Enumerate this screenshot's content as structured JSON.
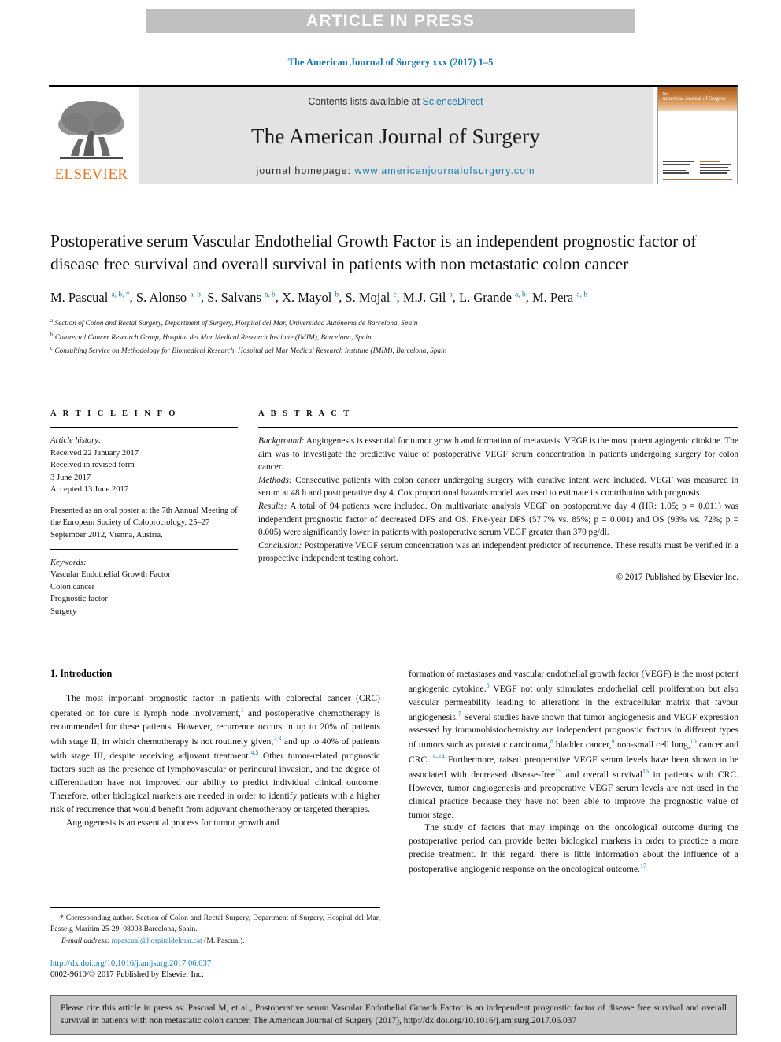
{
  "banner": {
    "text": "ARTICLE IN PRESS"
  },
  "running_head": {
    "text": "The American Journal of Surgery xxx (2017) 1–5"
  },
  "masthead": {
    "contents_prefix": "Contents lists available at ",
    "sciencedirect": "ScienceDirect",
    "journal_title": "The American Journal of Surgery",
    "homepage_prefix": "journal homepage: ",
    "homepage_url": "www.americanjournalofsurgery.com",
    "elsevier_wordmark": "ELSEVIER",
    "cover_title_small": "The",
    "cover_title": "American Journal of Surgery"
  },
  "article": {
    "title": "Postoperative serum Vascular Endothelial Growth Factor is an independent prognostic factor of disease free survival and overall survival in patients with non metastatic colon cancer",
    "authors": [
      {
        "name": "M. Pascual",
        "marks": "a, b, *"
      },
      {
        "name": "S. Alonso",
        "marks": "a, b"
      },
      {
        "name": "S. Salvans",
        "marks": "a, b"
      },
      {
        "name": "X. Mayol",
        "marks": "b"
      },
      {
        "name": "S. Mojal",
        "marks": "c"
      },
      {
        "name": "M.J. Gil",
        "marks": "a"
      },
      {
        "name": "L. Grande",
        "marks": "a, b"
      },
      {
        "name": "M. Pera",
        "marks": "a, b"
      }
    ],
    "affiliations": [
      {
        "mark": "a",
        "text": "Section of Colon and Rectal Surgery, Department of Surgery, Hospital del Mar, Universidad Autónoma de Barcelona, Spain"
      },
      {
        "mark": "b",
        "text": "Colorectal Cancer Research Group, Hospital del Mar Medical Research Institute (IMIM), Barcelona, Spain"
      },
      {
        "mark": "c",
        "text": "Consulting Service on Methodology for Biomedical Research, Hospital del Mar Medical Research Institute (IMIM), Barcelona, Spain"
      }
    ]
  },
  "article_info": {
    "heading": "A R T I C L E   I N F O",
    "history_label": "Article history:",
    "history_lines": [
      "Received 22 January 2017",
      "Received in revised form",
      "3 June 2017",
      "Accepted 13 June 2017"
    ],
    "presented": "Presented as an oral poster at the 7th Annual Meeting of the European Society of Coloproctology, 25–27 September 2012, Vienna, Austria.",
    "keywords_label": "Keywords:",
    "keywords": [
      "Vascular Endothelial Growth Factor",
      "Colon cancer",
      "Prognostic factor",
      "Surgery"
    ]
  },
  "abstract": {
    "heading": "A B S T R A C T",
    "sections": [
      {
        "label": "Background:",
        "text": " Angiogenesis is essential for tumor growth and formation of metastasis. VEGF is the most potent agiogenic citokine. The aim was to investigate the predictive value of postoperative VEGF serum concentration in patients undergoing surgery for colon cancer."
      },
      {
        "label": "Methods:",
        "text": " Consecutive patients with colon cancer undergoing surgery with curative intent were included. VEGF was measured in serum at 48 h and postoperative day 4. Cox proportional hazards model was used to estimate its contribution with prognosis."
      },
      {
        "label": "Results:",
        "text": " A total of 94 patients were included. On multivariate analysis VEGF on postoperative day 4 (HR: 1.05; p = 0.011) was independent prognostic factor of decreased DFS and OS. Five-year DFS (57.7% vs. 85%; p = 0.001) and OS (93% vs. 72%; p = 0.005) were significantly lower in patients with postoperative serum VEGF greater than 370 pg/dl."
      },
      {
        "label": "Conclusion:",
        "text": " Postoperative VEGF serum concentration was an independent predictor of recurrence. These results must be verified in a prospective independent testing cohort."
      }
    ],
    "copyright": "© 2017 Published by Elsevier Inc."
  },
  "body": {
    "section_heading": "1. Introduction",
    "left_paragraphs": [
      {
        "runs": [
          {
            "t": "The most important prognostic factor in patients with colorectal cancer (CRC) operated on for cure is lymph node involvement,"
          },
          {
            "sup": "1"
          },
          {
            "t": " and postoperative chemotherapy is recommended for these patients. However, recurrence occurs in up to 20% of patients with stage II, in which chemotherapy is not routinely given,"
          },
          {
            "sup": "2,3"
          },
          {
            "t": " and up to 40% of patients with stage III, despite receiving adjuvant treatment."
          },
          {
            "sup": "4,5"
          },
          {
            "t": " Other tumor-related prognostic factors such as the presence of lymphovascular or perineural invasion, and the degree of differentiation have not improved our ability to predict individual clinical outcome. Therefore, other biological markers are needed in order to identify patients with a higher risk of recurrence that would benefit from adjuvant chemotherapy or targeted therapies."
          }
        ]
      },
      {
        "runs": [
          {
            "t": "Angiogenesis is an essential process for tumor growth and"
          }
        ]
      }
    ],
    "right_paragraphs": [
      {
        "runs": [
          {
            "t": "formation of metastases and vascular endothelial growth factor (VEGF) is the most potent angiogenic cytokine."
          },
          {
            "sup": "6"
          },
          {
            "t": " VEGF not only stimulates endothelial cell proliferation but also vascular permeability leading to alterations in the extracellular matrix that favour angiogenesis."
          },
          {
            "sup": "7"
          },
          {
            "t": " Several studies have shown that tumor angiogenesis and VEGF expression assessed by immunohistochemistry are independent prognostic factors in different types of tumors such as prostatic carcinoma,"
          },
          {
            "sup": "8"
          },
          {
            "t": " bladder cancer,"
          },
          {
            "sup": "9"
          },
          {
            "t": " non-small cell lung,"
          },
          {
            "sup": "10"
          },
          {
            "t": " cancer and CRC."
          },
          {
            "sup": "11–14"
          },
          {
            "t": " Furthermore, raised preoperative VEGF serum levels have been shown to be associated with decreased disease-free"
          },
          {
            "sup": "15"
          },
          {
            "t": " and overall survival"
          },
          {
            "sup": "16"
          },
          {
            "t": " in patients with CRC. However, tumor angiogenesis and preoperative VEGF serum levels are not used in the clinical practice because they have not been able to improve the prognostic value of tumor stage."
          }
        ]
      },
      {
        "runs": [
          {
            "t": "The study of factors that may impinge on the oncological outcome during the postoperative period can provide better biological markers in order to practice a more precise treatment. In this regard, there is little information about the influence of a postoperative angiogenic response on the oncological outcome."
          },
          {
            "sup": "17"
          }
        ]
      }
    ]
  },
  "footnote": {
    "star": "*",
    "corresponding": " Corresponding author. Section of Colon and Rectal Surgery, Department of Surgery, Hospital del Mar, Passeig Marítim 25-29, 08003 Barcelona, Spain.",
    "email_label": "E-mail address:",
    "email": "mpascual@hospitaldelmar.cat",
    "email_suffix": " (M. Pascual)."
  },
  "doi_block": {
    "doi_url": "http://dx.doi.org/10.1016/j.amjsurg.2017.06.037",
    "issn_line": "0002-9610/© 2017 Published by Elsevier Inc."
  },
  "citation_box": {
    "text": "Please cite this article in press as: Pascual M, et al., Postoperative serum Vascular Endothelial Growth Factor is an independent prognostic factor of disease free survival and overall survival in patients with non metastatic colon cancer, The American Journal of Surgery (2017), http://dx.doi.org/10.1016/j.amjsurg.2017.06.037"
  },
  "colors": {
    "link": "#1a7aab",
    "banner_bg": "#c0c0c0",
    "masthead_bg": "#e3e3e3",
    "elsevier_orange": "#e87722",
    "cite_box_bg": "#c8c8c8"
  }
}
